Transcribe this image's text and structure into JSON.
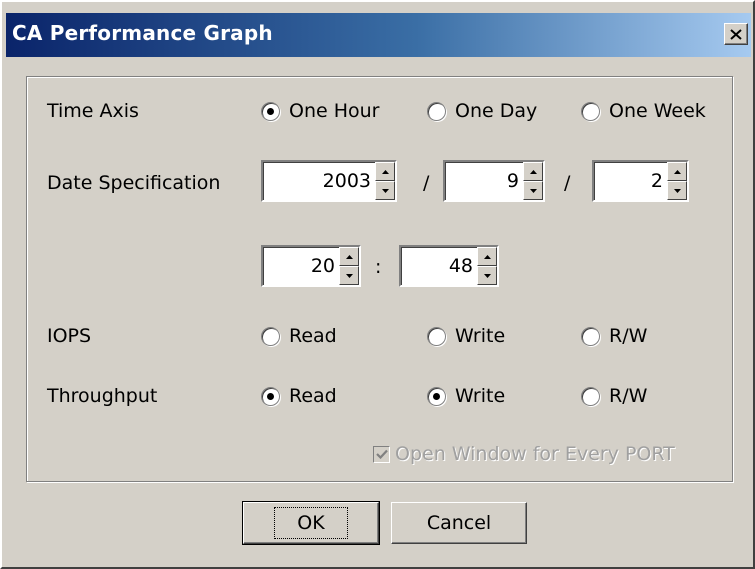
{
  "window": {
    "title": "CA Performance Graph",
    "close_label": "×"
  },
  "time_axis": {
    "label": "Time Axis",
    "options": [
      {
        "label": "One Hour",
        "selected": true
      },
      {
        "label": "One Day",
        "selected": false
      },
      {
        "label": "One Week",
        "selected": false
      }
    ]
  },
  "date_spec": {
    "label": "Date Specification",
    "year": "2003",
    "month": "9",
    "day": "2",
    "hour": "20",
    "minute": "48",
    "date_separator": "/",
    "time_separator": ":"
  },
  "iops": {
    "label": "IOPS",
    "options": [
      {
        "label": "Read",
        "selected": false
      },
      {
        "label": "Write",
        "selected": false
      },
      {
        "label": "R/W",
        "selected": false
      }
    ]
  },
  "throughput": {
    "label": "Throughput",
    "options": [
      {
        "label": "Read",
        "selected": true
      },
      {
        "label": "Write",
        "selected": true
      },
      {
        "label": "R/W",
        "selected": false
      }
    ]
  },
  "open_window": {
    "label": "Open Window for Every PORT",
    "checked": true,
    "disabled": true
  },
  "buttons": {
    "ok": "OK",
    "cancel": "Cancel"
  },
  "colors": {
    "title_gradient_start": "#0a246a",
    "title_gradient_end": "#a6caf0",
    "face": "#d4d0c8"
  }
}
